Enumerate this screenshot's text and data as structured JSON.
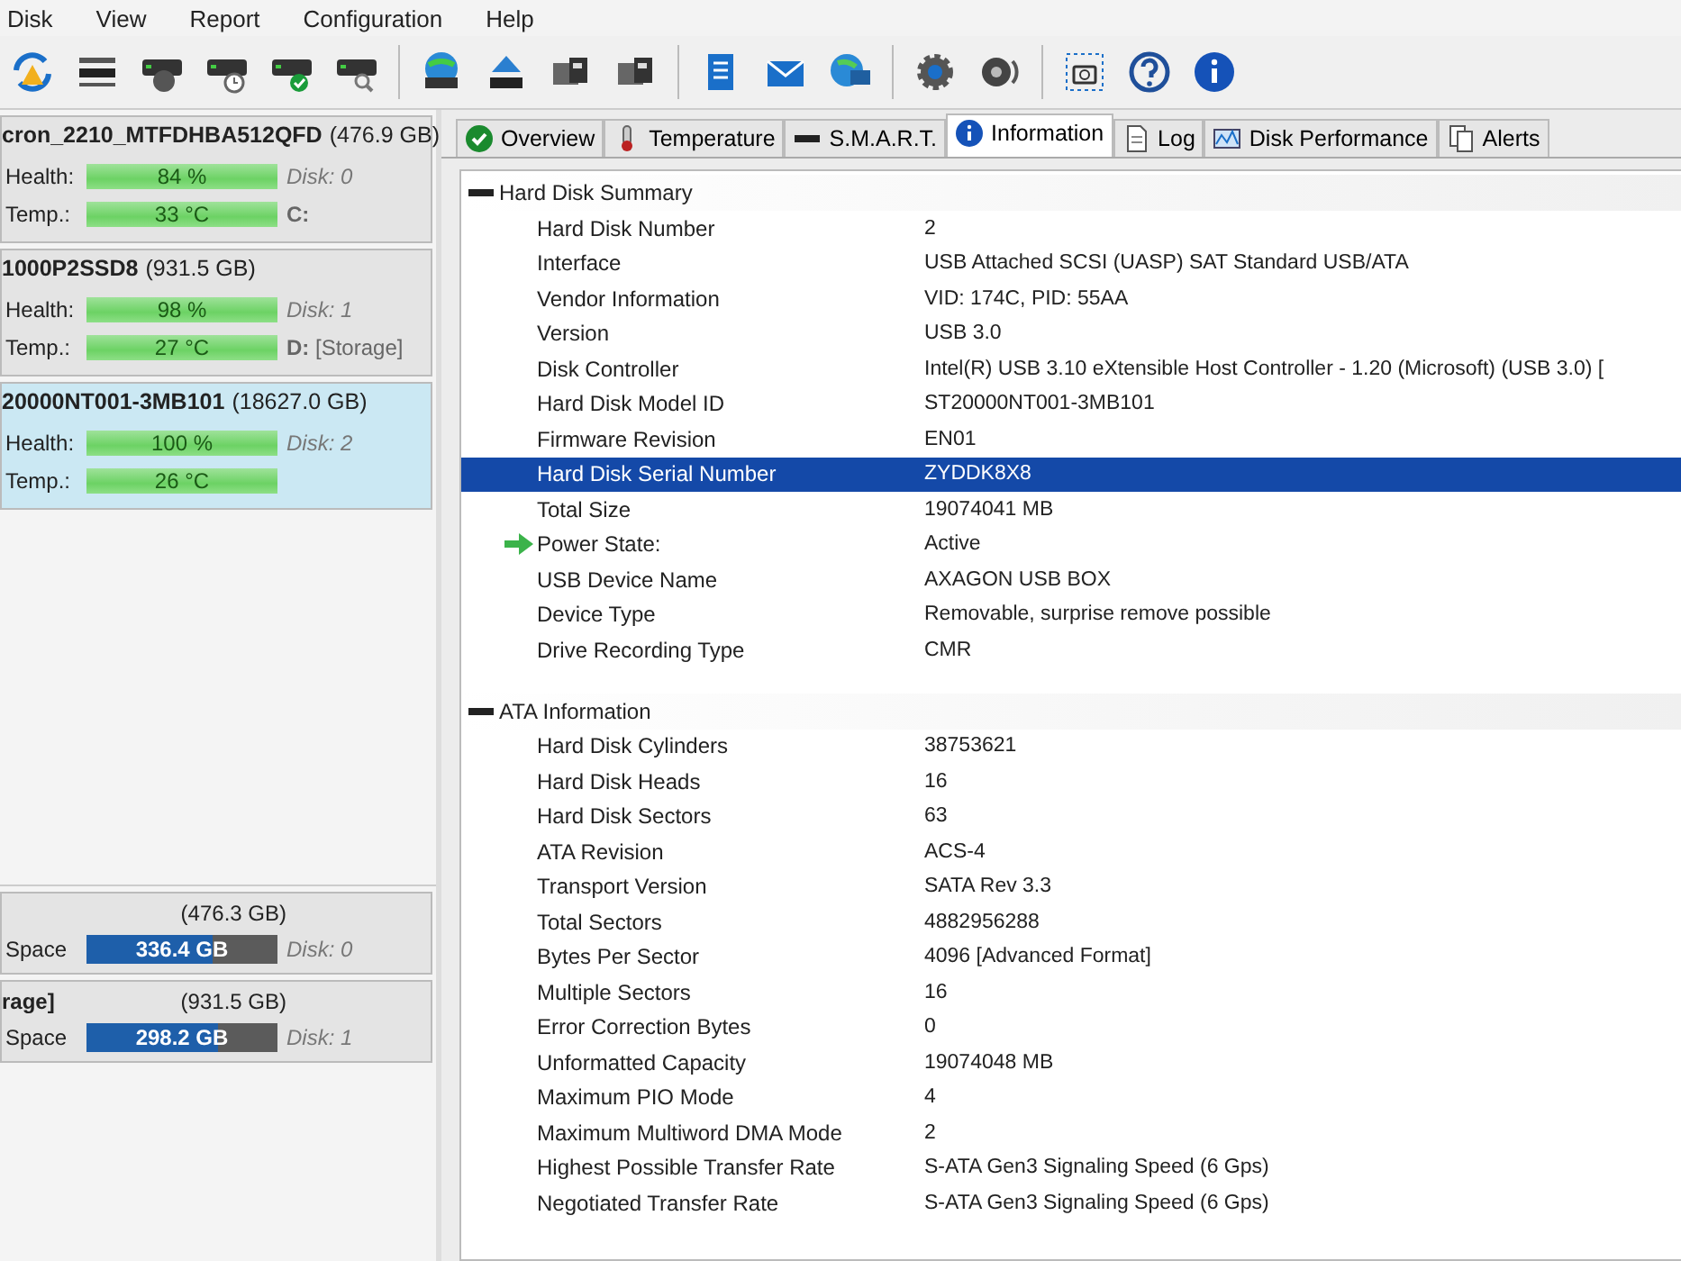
{
  "menu": [
    "Disk",
    "View",
    "Report",
    "Configuration",
    "Help"
  ],
  "disks": [
    {
      "model": "cron_2210_MTFDHBA512QFD",
      "size": "(476.9 GB)",
      "health_label": "Health:",
      "temp_label": "Temp.:",
      "health": "84 %",
      "temp": "33 °C",
      "disk": "Disk: 0",
      "drive": "**C:**",
      "selected": false
    },
    {
      "model": "1000P2SSD8",
      "size": "(931.5 GB)",
      "health_label": "Health:",
      "temp_label": "Temp.:",
      "health": "98 %",
      "temp": "27 °C",
      "disk": "Disk: 1",
      "drive": "**D:** [Storage]",
      "selected": false
    },
    {
      "model": "20000NT001-3MB101",
      "size": "(18627.0 GB)",
      "health_label": "Health:",
      "temp_label": "Temp.:",
      "health": "100 %",
      "temp": "26 °C",
      "disk": "Disk: 2",
      "selected": true
    }
  ],
  "partitions": [
    {
      "size": "(476.3 GB)",
      "label": "Space",
      "free": "336.4 GB",
      "level": 0.66,
      "disk": "Disk: 0"
    },
    {
      "name": "rage]",
      "size": "(931.5 GB)",
      "label": "Space",
      "free": "298.2 GB",
      "level": 0.69,
      "disk": "Disk: 1"
    }
  ],
  "tabs": [
    {
      "label": "Overview",
      "selected": false
    },
    {
      "label": "Temperature",
      "selected": false
    },
    {
      "label": "S.M.A.R.T.",
      "selected": false
    },
    {
      "label": "Information",
      "selected": true
    },
    {
      "label": "Log",
      "selected": false
    },
    {
      "label": "Disk Performance",
      "selected": false
    },
    {
      "label": "Alerts",
      "selected": false
    }
  ],
  "sections": [
    {
      "title": "Hard Disk Summary",
      "rows": [
        {
          "label": "Hard Disk Number",
          "value": "2",
          "selected": false
        },
        {
          "label": "Interface",
          "value": "USB Attached SCSI (UASP) SAT Standard USB/ATA",
          "selected": false
        },
        {
          "label": "Vendor Information",
          "value": "VID: 174C, PID: 55AA",
          "selected": false
        },
        {
          "label": "Version",
          "value": "USB 3.0",
          "selected": false
        },
        {
          "label": "Disk Controller",
          "value": "Intel(R) USB 3.10 eXtensible Host Controller - 1.20 (Microsoft) (USB 3.0) [",
          "selected": false
        },
        {
          "label": "Hard Disk Model ID",
          "value": "ST20000NT001-3MB101",
          "selected": false
        },
        {
          "label": "Firmware Revision",
          "value": "EN01",
          "selected": false
        },
        {
          "label": "Hard Disk Serial Number",
          "value": "ZYDDK8X8",
          "selected": true
        },
        {
          "label": "Total Size",
          "value": "19074041 MB",
          "selected": false
        },
        {
          "label": "Power State:",
          "value": "Active",
          "selected": false,
          "arrow": true
        },
        {
          "label": "USB Device Name",
          "value": "AXAGON USB BOX",
          "selected": false
        },
        {
          "label": "Device Type",
          "value": "Removable, surprise remove possible",
          "selected": false
        },
        {
          "label": "Drive Recording Type",
          "value": "CMR",
          "selected": false
        }
      ]
    },
    {
      "title": "ATA Information",
      "rows": [
        {
          "label": "Hard Disk Cylinders",
          "value": "38753621",
          "selected": false
        },
        {
          "label": "Hard Disk Heads",
          "value": "16",
          "selected": false
        },
        {
          "label": "Hard Disk Sectors",
          "value": "63",
          "selected": false
        },
        {
          "label": "ATA Revision",
          "value": "ACS-4",
          "selected": false
        },
        {
          "label": "Transport Version",
          "value": "SATA Rev 3.3",
          "selected": false
        },
        {
          "label": "Total Sectors",
          "value": "4882956288",
          "selected": false
        },
        {
          "label": "Bytes Per Sector",
          "value": "4096 [Advanced Format]",
          "selected": false
        },
        {
          "label": "Multiple Sectors",
          "value": "16",
          "selected": false
        },
        {
          "label": "Error Correction Bytes",
          "value": "0",
          "selected": false
        },
        {
          "label": "Unformatted Capacity",
          "value": "19074048 MB",
          "selected": false
        },
        {
          "label": "Maximum PIO Mode",
          "value": "4",
          "selected": false
        },
        {
          "label": "Maximum Multiword DMA Mode",
          "value": "2",
          "selected": false
        },
        {
          "label": "Highest Possible Transfer Rate",
          "value": "S-ATA Gen3 Signaling Speed (6 Gps)",
          "selected": false
        },
        {
          "label": "Negotiated Transfer Rate",
          "value": "S-ATA Gen3 Signaling Speed (6 Gps)",
          "selected": false
        }
      ]
    }
  ]
}
